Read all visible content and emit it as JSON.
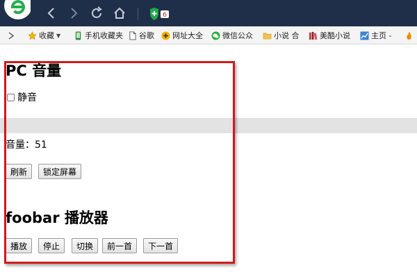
{
  "browser": {
    "ext_badge": "6",
    "bookmarks": [
      {
        "label": "收藏",
        "icon": "star-icon"
      },
      {
        "label": "手机收藏夹",
        "icon": "phone-icon"
      },
      {
        "label": "谷歌",
        "icon": "page-icon"
      },
      {
        "label": "网址大全",
        "icon": "plus-icon"
      },
      {
        "label": "微信公众",
        "icon": "wechat-icon"
      },
      {
        "label": "小说 合",
        "icon": "folder-icon"
      },
      {
        "label": "美酷小说",
        "icon": "book-icon"
      },
      {
        "label": "主页 -",
        "icon": "chart-icon"
      }
    ]
  },
  "page": {
    "pc_title": "PC 音量",
    "mute_label": "静音",
    "volume_label": "音量：51",
    "refresh_button": "刷新",
    "lock_button": "锁定屏幕",
    "foobar_title": "foobar 播放器",
    "player_buttons": [
      "播放",
      "停止",
      "切换",
      "前一首",
      "下一首"
    ]
  },
  "colors": {
    "titlebar": "#1f2f49",
    "highlight_border": "#d11a1a",
    "band": "#e3e3e3"
  }
}
